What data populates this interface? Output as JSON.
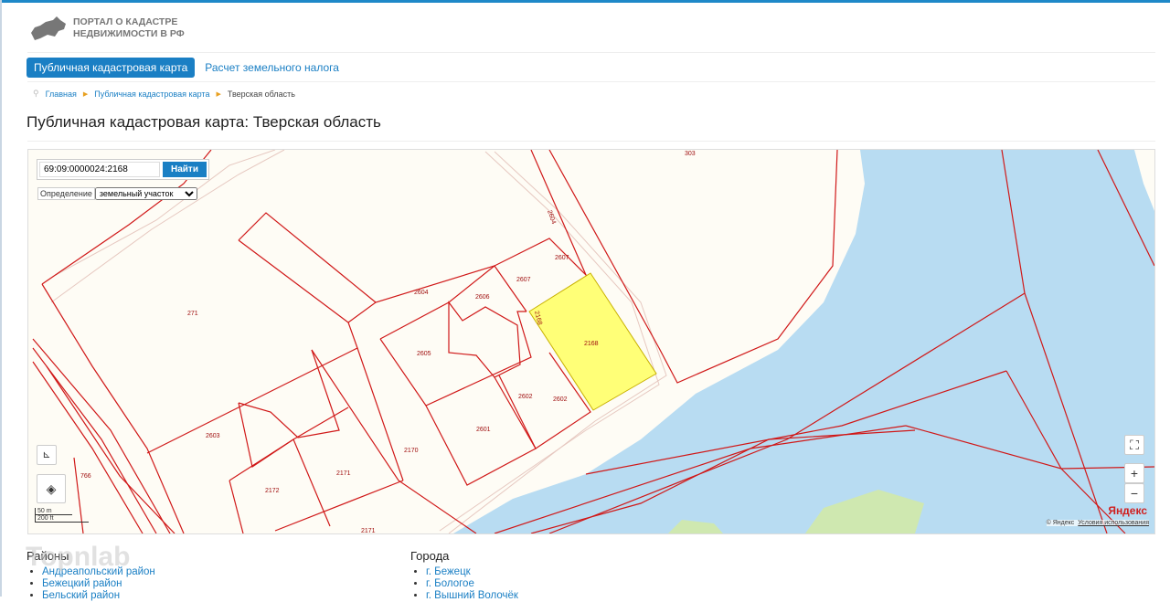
{
  "header": {
    "logo_line1": "ПОРТАЛ О КАДАСТРЕ",
    "logo_line2": "НЕДВИЖИМОСТИ В РФ"
  },
  "nav": {
    "active": "Публичная кадастровая карта",
    "link": "Расчет земельного налога"
  },
  "breadcrumb": [
    "Главная",
    "Публичная кадастровая карта",
    "Тверская область"
  ],
  "page_title": "Публичная кадастровая карта: Тверская область",
  "map": {
    "search_value": "69:09:0000024:2168",
    "search_button": "Найти",
    "definition_label": "Определение",
    "definition_value": "земельный участок",
    "parcels": [
      "303",
      "2604",
      "2607",
      "271",
      "2604",
      "2606",
      "2607",
      "2168",
      "2168",
      "2605",
      "2602",
      "2602",
      "2601",
      "2603",
      "2170",
      "2171",
      "2172",
      "766",
      "2171"
    ],
    "scale_m": "50 m",
    "scale_ft": "200 ft",
    "brand": "Яндекс",
    "copyright": "© Яндекс",
    "terms": "Условия использования",
    "zoom_in": "+",
    "zoom_out": "−",
    "colors": {
      "parcel_line": "#d01818",
      "selected_fill": "#ffff77",
      "water": "#b8dcf2"
    }
  },
  "districts": {
    "title": "Районы",
    "items": [
      "Андреапольский район",
      "Бежецкий район",
      "Бельский район"
    ]
  },
  "cities": {
    "title": "Города",
    "items": [
      "г. Бежецк",
      "г. Бологое",
      "г. Вышний Волочёк"
    ]
  },
  "watermark": "Topnlab"
}
